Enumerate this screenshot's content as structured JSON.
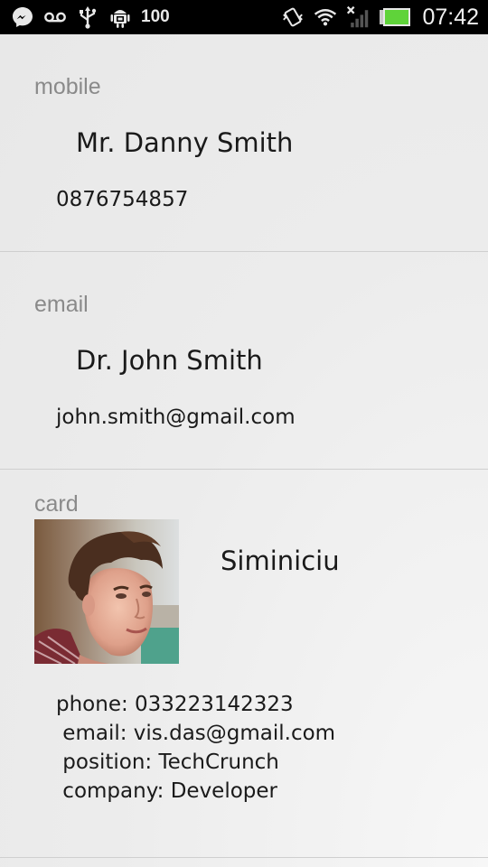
{
  "status_bar": {
    "battery_level_text": "100",
    "time": "07:42",
    "icons": [
      "messenger-icon",
      "voicemail-icon",
      "usb-icon",
      "android-debug-icon",
      "vibrate-icon",
      "wifi-icon",
      "no-signal-icon",
      "battery-icon"
    ],
    "battery_fill_fraction": 1.0,
    "battery_color": "#5fd33a"
  },
  "sections": {
    "mobile": {
      "label": "mobile",
      "name": "Mr. Danny Smith",
      "value": "0876754857"
    },
    "email": {
      "label": "email",
      "name": "Dr. John Smith",
      "value": "john.smith@gmail.com"
    },
    "card": {
      "label": "card",
      "name": "Siminiciu",
      "details": [
        "phone: 033223142323",
        " email: vis.das@gmail.com",
        " position: TechCrunch",
        " company: Developer"
      ]
    }
  }
}
